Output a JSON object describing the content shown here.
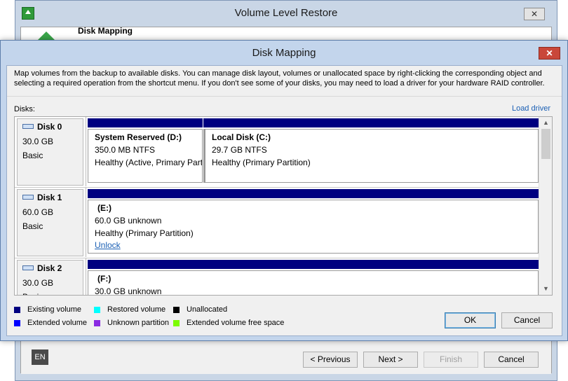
{
  "background_window": {
    "title": "Volume Level Restore",
    "header_title": "Disk Mapping",
    "language": "EN",
    "buttons": {
      "previous": "< Previous",
      "next": "Next >",
      "finish": "Finish",
      "cancel": "Cancel"
    }
  },
  "dialog": {
    "title": "Disk Mapping",
    "close_glyph": "✕",
    "description": "Map volumes from the backup to available disks. You can manage disk layout, volumes or unallocated space by right-clicking the corresponding object and selecting a required operation from the shortcut menu. If you don't see some of your disks, you may need to load a driver for your hardware RAID controller.",
    "disks_label": "Disks:",
    "load_driver": "Load driver",
    "disks": [
      {
        "name": "Disk 0",
        "size": "30.0 GB",
        "type": "Basic",
        "volumes": [
          {
            "name": "System Reserved (D:)",
            "size_fs": "350.0 MB NTFS",
            "status": "Healthy (Active, Primary Partition)"
          },
          {
            "name": "Local Disk (C:)",
            "size_fs": "29.7 GB NTFS",
            "status": "Healthy (Primary Partition)"
          }
        ]
      },
      {
        "name": "Disk 1",
        "size": "60.0 GB",
        "type": "Basic",
        "volumes": [
          {
            "name": "(E:)",
            "size_fs": "60.0 GB unknown",
            "status": "Healthy (Primary Partition)",
            "link": "Unlock"
          }
        ]
      },
      {
        "name": "Disk 2",
        "size": "30.0 GB",
        "type": "Basic",
        "volumes": [
          {
            "name": "(F:)",
            "size_fs": "30.0 GB unknown"
          }
        ]
      }
    ],
    "legend": [
      {
        "label": "Existing volume",
        "color": "#000080"
      },
      {
        "label": "Extended volume",
        "color": "#0000ff"
      },
      {
        "label": "Restored volume",
        "color": "#00ffff"
      },
      {
        "label": "Unknown partition",
        "color": "#8a2be2"
      },
      {
        "label": "Unallocated",
        "color": "#000000"
      },
      {
        "label": "Extended volume free space",
        "color": "#7cfc00"
      }
    ],
    "buttons": {
      "ok": "OK",
      "cancel": "Cancel"
    }
  }
}
